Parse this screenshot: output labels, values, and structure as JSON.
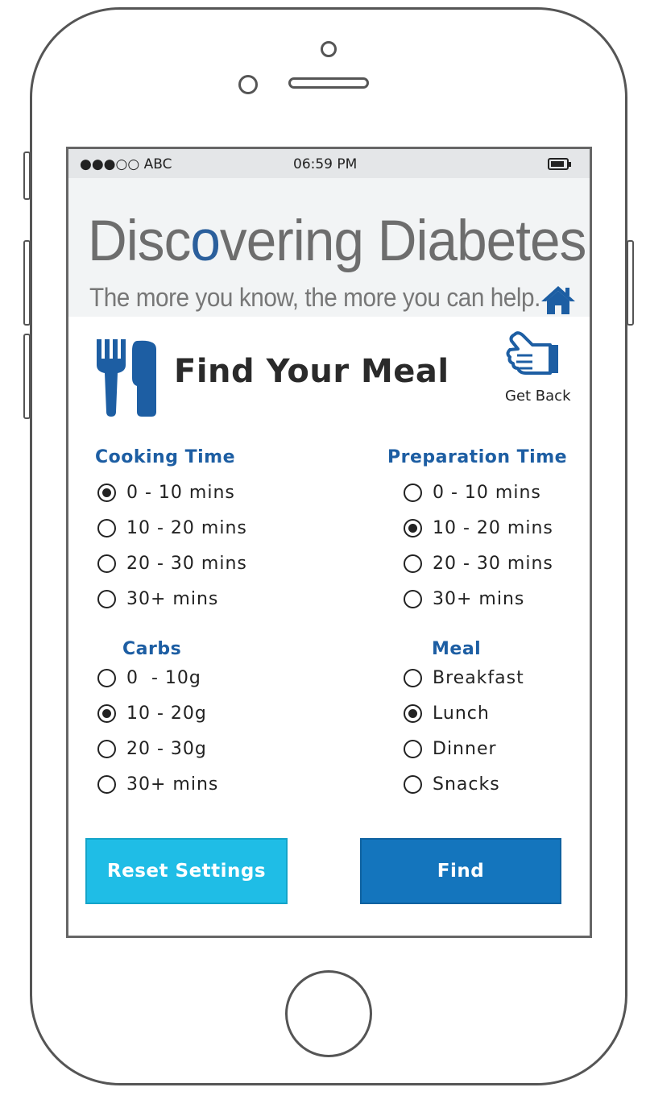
{
  "status_bar": {
    "carrier": "●●●○○ ABC",
    "time": "06:59 PM"
  },
  "banner": {
    "title_before": "Disc",
    "title_o": "o",
    "title_after": "vering Diabetes",
    "tagline": "The more you know, the more you can help."
  },
  "page": {
    "title": "Find Your Meal",
    "get_back": "Get Back"
  },
  "filters": {
    "cooking_time": {
      "label": "Cooking Time",
      "options": [
        "0 - 10 mins",
        "10 - 20 mins",
        "20 - 30 mins",
        "30+ mins"
      ],
      "selected": "0 - 10 mins"
    },
    "preparation_time": {
      "label": "Preparation Time",
      "options": [
        "0 - 10 mins",
        "10 - 20 mins",
        "20 - 30 mins",
        "30+ mins"
      ],
      "selected": "10 - 20 mins"
    },
    "carbs": {
      "label": "Carbs",
      "options": [
        "0  - 10g",
        "10 - 20g",
        "20 - 30g",
        "30+ mins"
      ],
      "selected": "10 - 20g"
    },
    "meal": {
      "label": "Meal",
      "options": [
        "Breakfast",
        "Lunch",
        "Dinner",
        "Snacks"
      ],
      "selected": "Lunch"
    }
  },
  "buttons": {
    "reset": "Reset Settings",
    "find": "Find"
  },
  "colors": {
    "accent_dark_blue": "#1d5ea3",
    "reset_button": "#1fbde6",
    "find_button": "#1475bd",
    "banner_background": "#f2f4f5",
    "status_bar_background": "#e4e6e8"
  },
  "icons": [
    "home-icon",
    "utensils-icon",
    "pointing-hand-icon",
    "battery-icon"
  ]
}
